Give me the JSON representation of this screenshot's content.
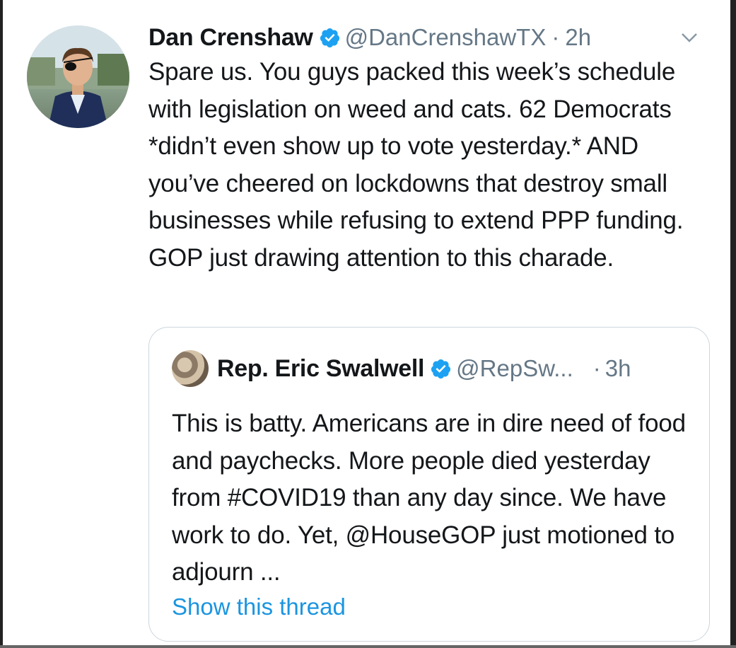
{
  "tweet": {
    "author_name": "Dan Crenshaw",
    "handle": "@DanCrenshawTX",
    "separator": "·",
    "time": "2h",
    "text": "Spare us. You guys packed this week’s schedule with legislation on weed and cats. 62 Democrats *didn’t even show up to vote yesterday.* AND you’ve cheered on lockdowns that destroy small businesses while refusing to extend PPP funding. GOP just drawing attention to this charade."
  },
  "quoted_tweet": {
    "author_name": "Rep. Eric Swalwell",
    "handle": "@RepSw...",
    "separator": "·",
    "time": "3h",
    "text": "This is batty. Americans are in dire need of food and paychecks. More people died yesterday from #COVID19 than any day since. We have work to do. Yet, @HouseGOP just motioned to adjourn ...",
    "show_thread_label": "Show this thread"
  },
  "icons": {
    "verified": "verified-badge-icon",
    "caret": "chevron-down-icon"
  },
  "colors": {
    "verified_blue": "#1da1f2",
    "link_blue": "#1b95e0",
    "secondary_text": "#657786",
    "border": "#ccd6dd"
  }
}
